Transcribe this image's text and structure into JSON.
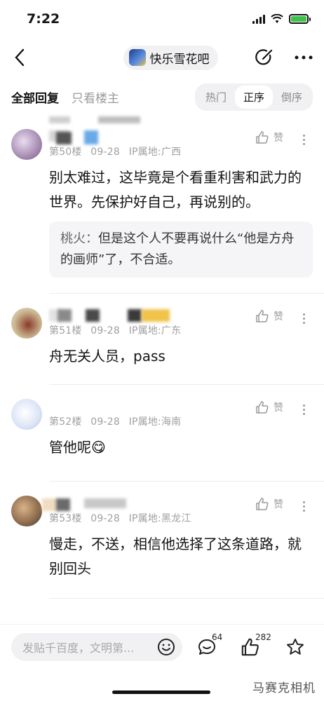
{
  "status": {
    "time": "7:22"
  },
  "header": {
    "forum_name": "快乐雪花吧"
  },
  "tabs": {
    "all": "全部回复",
    "op_only": "只看楼主"
  },
  "sort": {
    "options": [
      "热门",
      "正序",
      "倒序"
    ],
    "selected": "正序"
  },
  "comments": [
    {
      "floor": "第50楼",
      "date": "09-28",
      "location": "IP属地:广西",
      "like_label": "赞",
      "text": "别太难过，这毕竟是个看重利害和武力的世界。先保护好自己，再说别的。",
      "reply": {
        "author": "桃火：",
        "text": "但是这个人不要再说什么“他是方舟的画师”了，不合适。"
      }
    },
    {
      "floor": "第51楼",
      "date": "09-28",
      "location": "IP属地:广东",
      "like_label": "赞",
      "text": "舟无关人员，pass"
    },
    {
      "floor": "第52楼",
      "date": "09-28",
      "location": "IP属地:海南",
      "like_label": "赞",
      "text": "管他呢😋"
    },
    {
      "floor": "第53楼",
      "date": "09-28",
      "location": "IP属地:黑龙江",
      "like_label": "赞",
      "text": "慢走，不送，相信他选择了这条道路，就别回头"
    }
  ],
  "bottom": {
    "input_placeholder": "发贴千百度，文明第...",
    "comment_count": "64",
    "like_count": "282"
  },
  "watermark": "马赛克相机",
  "colors": {
    "battery": "#3ec24a",
    "text": "#141414",
    "meta": "#a0a0a0"
  }
}
